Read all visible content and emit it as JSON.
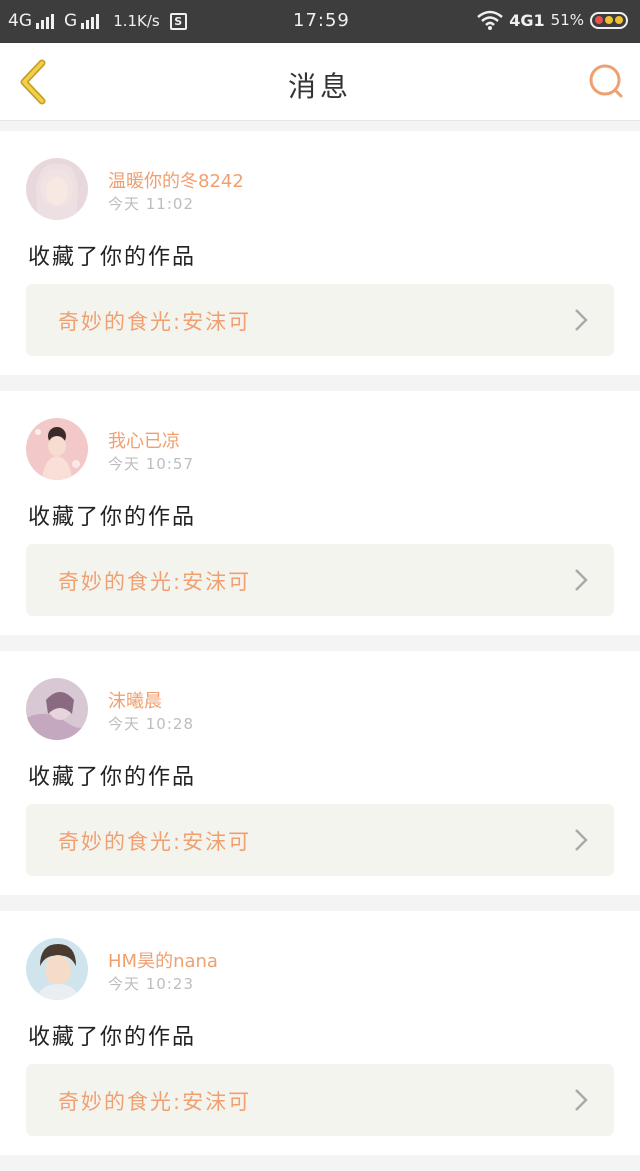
{
  "status_bar": {
    "net1": "4G",
    "net2": "G",
    "speed": "1.1K/s",
    "s_icon": "S",
    "time": "17:59",
    "net3": "4G1",
    "battery": "51%"
  },
  "header": {
    "title": "消息",
    "back_icon": "chevron-left-icon",
    "search_icon": "search-icon"
  },
  "messages": [
    {
      "username": "温暖你的冬8242",
      "time": "今天 11:02",
      "action": "收藏了你的作品",
      "work_title": "奇妙的食光:安沫可"
    },
    {
      "username": "我心已凉",
      "time": "今天 10:57",
      "action": "收藏了你的作品",
      "work_title": "奇妙的食光:安沫可"
    },
    {
      "username": "沫曦晨",
      "time": "今天 10:28",
      "action": "收藏了你的作品",
      "work_title": "奇妙的食光:安沫可"
    },
    {
      "username": "HM昊的nana",
      "time": "今天 10:23",
      "action": "收藏了你的作品",
      "work_title": "奇妙的食光:安沫可"
    }
  ],
  "colors": {
    "accent": "#f0a070",
    "back_icon": "#e8c040",
    "status_bar_bg": "#3d3d3d"
  }
}
